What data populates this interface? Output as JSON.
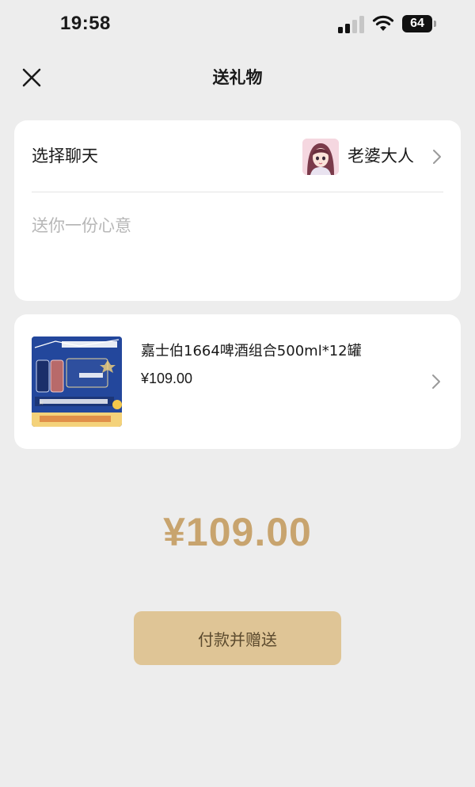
{
  "status_bar": {
    "time": "19:58",
    "battery": "64",
    "icons": [
      "signal-icon",
      "wifi-icon",
      "battery-icon"
    ]
  },
  "nav": {
    "title": "送礼物",
    "close_icon": "close-icon"
  },
  "chat_select": {
    "label": "选择聊天",
    "recipient_name": "老婆大人",
    "avatar_icon": "avatar",
    "chevron_icon": "chevron-right-icon"
  },
  "message": {
    "placeholder": "送你一份心意",
    "value": ""
  },
  "product": {
    "name": "嘉士伯1664啤酒组合500ml*12罐",
    "price": "¥109.00",
    "image_icon": "product-image",
    "chevron_icon": "chevron-right-icon"
  },
  "total": {
    "amount": "¥109.00"
  },
  "pay_button": {
    "label": "付款并赠送"
  },
  "colors": {
    "background": "#ededed",
    "card": "#ffffff",
    "accent_gold": "#c8a46e",
    "button_bg": "#dfc596",
    "button_text": "#5b4a2e",
    "placeholder": "#b7b7b7"
  }
}
